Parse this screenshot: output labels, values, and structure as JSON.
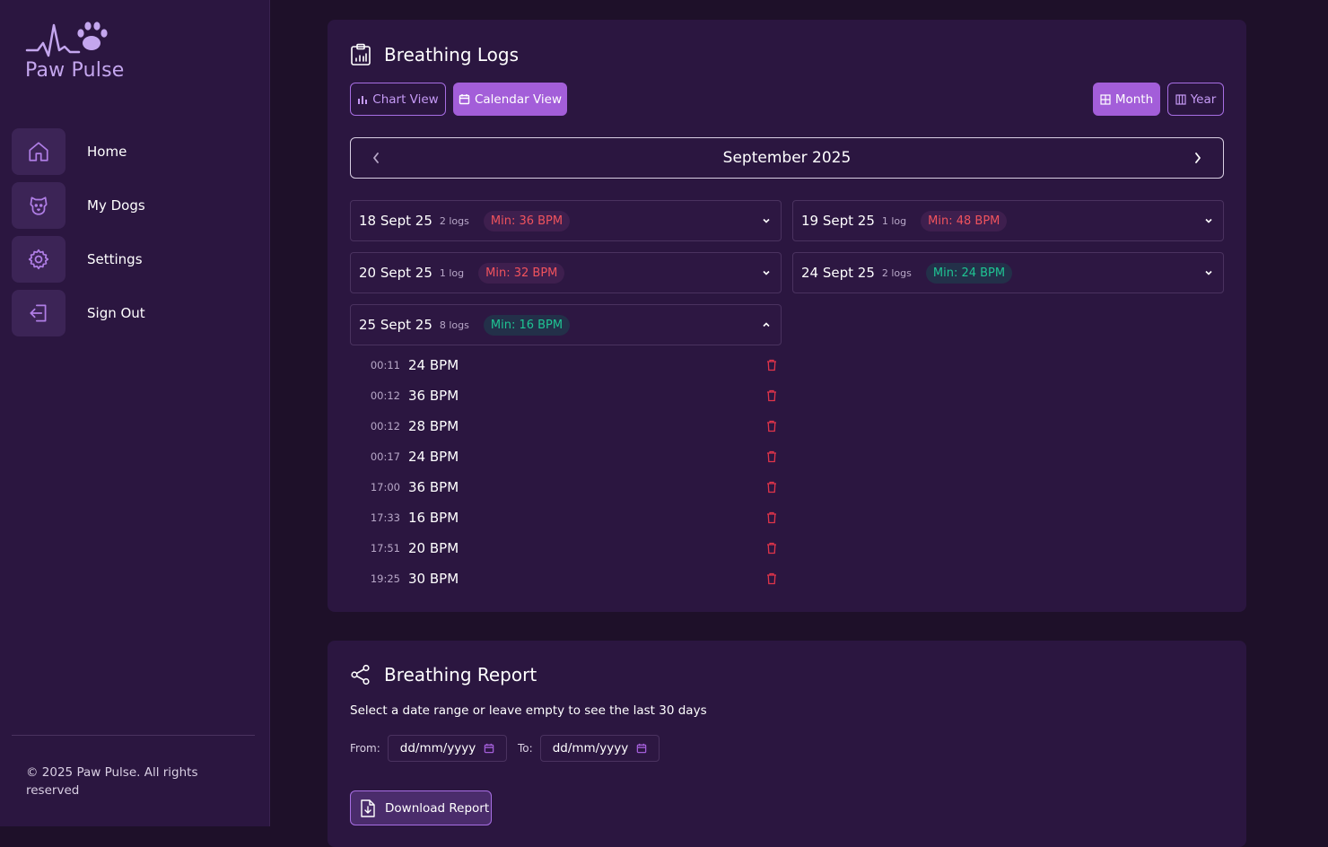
{
  "sidebar": {
    "logo_text": "Paw Pulse",
    "items": [
      {
        "label": "Home",
        "icon": "home-icon"
      },
      {
        "label": "My Dogs",
        "icon": "dog-icon"
      },
      {
        "label": "Settings",
        "icon": "gear-icon"
      },
      {
        "label": "Sign Out",
        "icon": "sign-out-icon"
      }
    ],
    "copyright": "© 2025 Paw Pulse. All rights reserved"
  },
  "logs": {
    "title": "Breathing Logs",
    "view_buttons": {
      "chart": "Chart View",
      "calendar": "Calendar View",
      "active": "calendar"
    },
    "range_buttons": {
      "month": "Month",
      "year": "Year",
      "active": "month"
    },
    "month_label": "September 2025",
    "days": [
      {
        "date": "18 Sept 25",
        "count": "2 logs",
        "min": "Min: 36 BPM",
        "status": "red",
        "expanded": false
      },
      {
        "date": "19 Sept 25",
        "count": "1 log",
        "min": "Min: 48 BPM",
        "status": "red",
        "expanded": false
      },
      {
        "date": "20 Sept 25",
        "count": "1 log",
        "min": "Min: 32 BPM",
        "status": "red",
        "expanded": false
      },
      {
        "date": "24 Sept 25",
        "count": "2 logs",
        "min": "Min: 24 BPM",
        "status": "green",
        "expanded": false
      },
      {
        "date": "25 Sept 25",
        "count": "8 logs",
        "min": "Min: 16 BPM",
        "status": "green",
        "expanded": true
      }
    ],
    "entries": [
      {
        "time": "00:11",
        "bpm": "24 BPM"
      },
      {
        "time": "00:12",
        "bpm": "36 BPM"
      },
      {
        "time": "00:12",
        "bpm": "28 BPM"
      },
      {
        "time": "00:17",
        "bpm": "24 BPM"
      },
      {
        "time": "17:00",
        "bpm": "36 BPM"
      },
      {
        "time": "17:33",
        "bpm": "16 BPM"
      },
      {
        "time": "17:51",
        "bpm": "20 BPM"
      },
      {
        "time": "19:25",
        "bpm": "30 BPM"
      }
    ]
  },
  "report": {
    "title": "Breathing Report",
    "description": "Select a date range or leave empty to see the last 30 days",
    "from_label": "From:",
    "to_label": "To:",
    "from_value": "dd/mm/yyyy",
    "to_value": "dd/mm/yyyy",
    "download_label": "Download Report"
  },
  "colors": {
    "background": "#1e1029",
    "panel": "#2b1640",
    "accent": "#a35ed9",
    "alert_red": "#f0535d",
    "ok_green": "#1fc493"
  }
}
